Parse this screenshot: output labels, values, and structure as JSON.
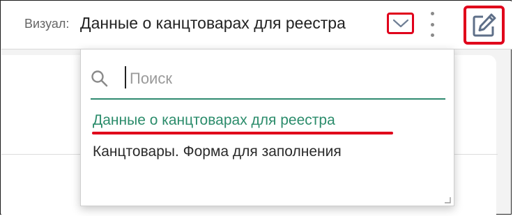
{
  "header": {
    "visual_label": "Визуал:",
    "visual_title": "Данные о канцтоварах для реестра"
  },
  "icons": {
    "dropdown": "chevron-down-icon",
    "menu": "more-vertical-icon",
    "edit": "edit-pencil-icon",
    "search": "search-icon"
  },
  "dropdown": {
    "search_placeholder": "Поиск",
    "search_value": "",
    "options": [
      {
        "label": "Данные о канцтоварах для реестра",
        "selected": true
      },
      {
        "label": "Канцтовары. Форма для заполнения",
        "selected": false
      }
    ]
  },
  "colors": {
    "highlight_red": "#e0001b",
    "selected_green": "#2b8c6b",
    "icon_slate": "#5e6f88"
  }
}
